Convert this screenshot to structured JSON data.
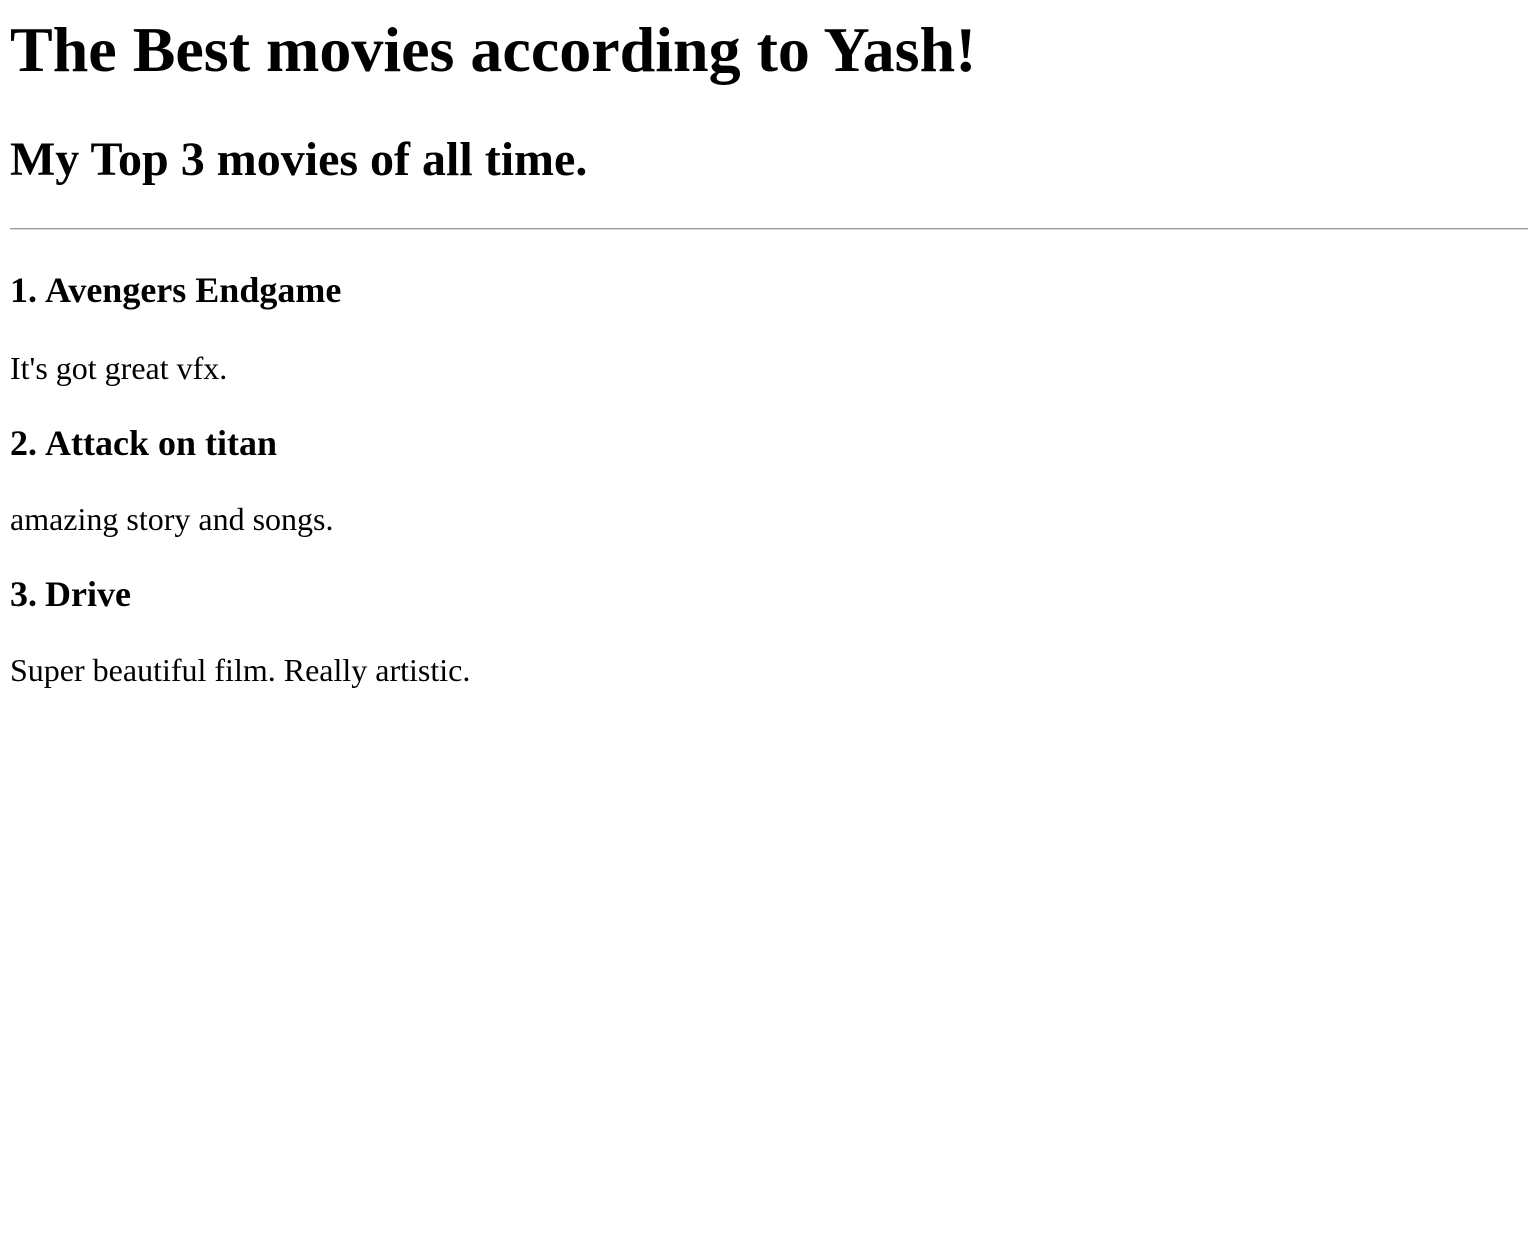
{
  "header": {
    "title": "The Best movies according to Yash!",
    "subtitle": "My Top 3 movies of all time."
  },
  "movies": [
    {
      "number": "1.",
      "title": "Avengers Endgame",
      "description": "It's got great vfx."
    },
    {
      "number": "2.",
      "title": "Attack on titan",
      "description": "amazing story and songs."
    },
    {
      "number": "3.",
      "title": "Drive",
      "description": "Super beautiful film. Really artistic."
    }
  ]
}
